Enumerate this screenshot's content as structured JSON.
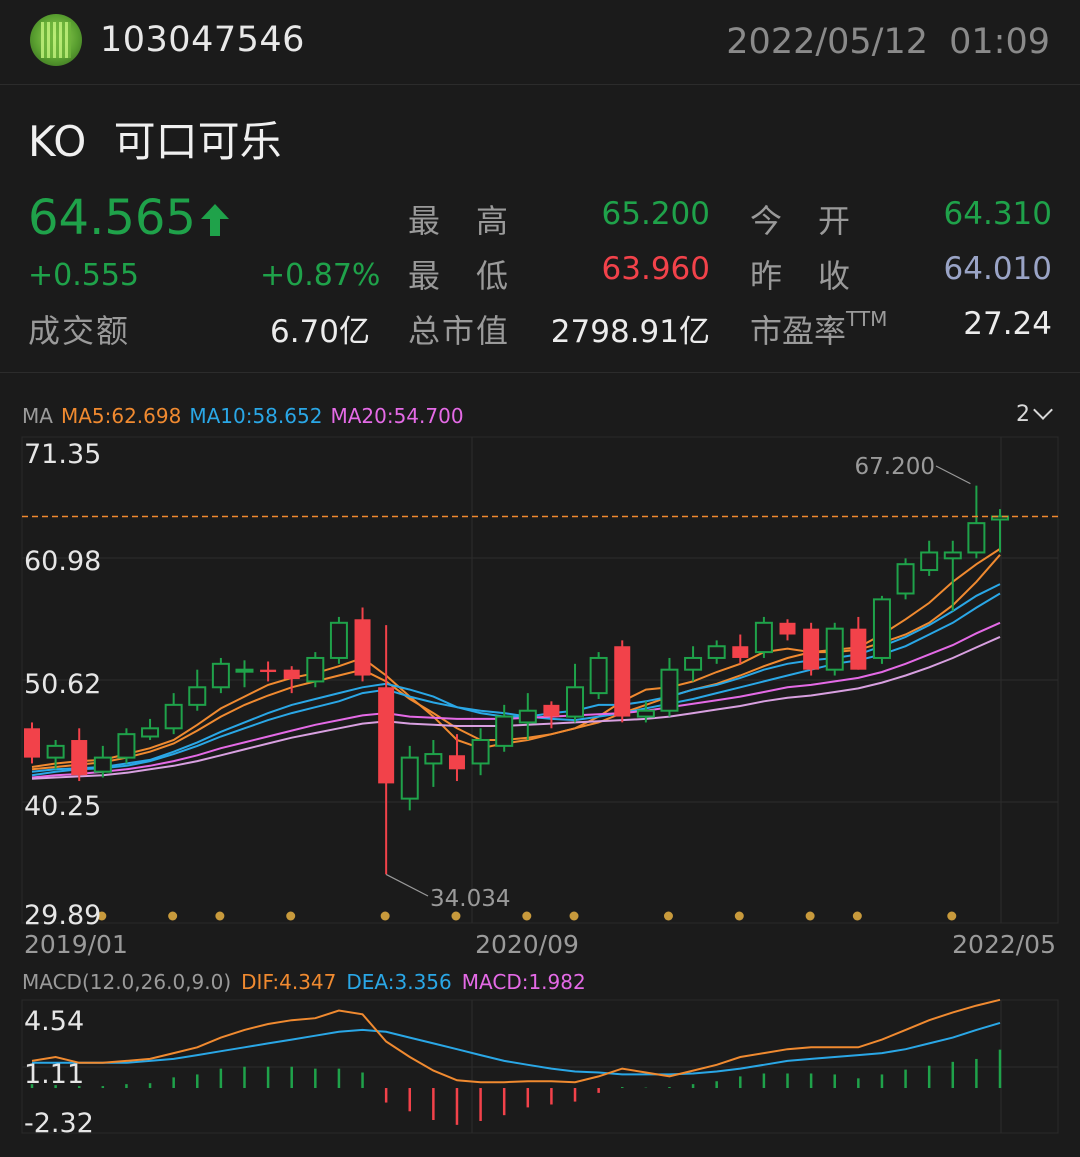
{
  "header": {
    "user_id": "103047546",
    "datetime": "2022/05/12  01:09"
  },
  "stock": {
    "symbol": "KO",
    "name": "可口可乐",
    "title": "KO  可口可乐",
    "price": "64.565",
    "change": "+0.555",
    "change_pct": "+0.87%",
    "turnover_label": "成交额",
    "turnover": "6.70亿",
    "high_label": "最　高",
    "high": "65.200",
    "low_label": "最　低",
    "low": "63.960",
    "mktcap_label": "总市值",
    "mktcap": "2798.91亿",
    "open_label": "今　开",
    "open": "64.310",
    "prevclose_label": "昨　收",
    "prevclose": "64.010",
    "pe_label": "市盈率",
    "pe_sup": "TTM",
    "pe": "27.24"
  },
  "colors": {
    "up": "#1fa24a",
    "down": "#f2424a",
    "ma5": "#f08a30",
    "ma10": "#2aa7e6",
    "ma20": "#e46ae6",
    "ma_extra": "#d8a0e0",
    "prevclose": "#9aa4c6",
    "event_dot": "#c89a3c"
  },
  "chart_data": [
    {
      "type": "candlestick",
      "period": "monthly",
      "indicator_label": "MA",
      "legend": [
        "MA5:62.698",
        "MA10:58.652",
        "MA20:54.700"
      ],
      "period_selector": "2",
      "y_ticks": [
        "71.35",
        "60.98",
        "50.62",
        "40.25",
        "29.89"
      ],
      "ylim": [
        29.89,
        71.35
      ],
      "x_ticks": [
        "2019/01",
        "2020/09",
        "2022/05"
      ],
      "annotations": {
        "max": "67.200",
        "min": "34.034"
      },
      "last_price": 64.565,
      "candles": [
        {
          "o": 46.5,
          "c": 44.0,
          "h": 47.0,
          "l": 43.5
        },
        {
          "o": 44.0,
          "c": 45.0,
          "h": 45.5,
          "l": 43.0
        },
        {
          "o": 45.5,
          "c": 42.5,
          "h": 46.5,
          "l": 42.0
        },
        {
          "o": 42.8,
          "c": 44.0,
          "h": 45.0,
          "l": 42.3
        },
        {
          "o": 44.0,
          "c": 46.0,
          "h": 46.5,
          "l": 43.5
        },
        {
          "o": 45.8,
          "c": 46.5,
          "h": 47.3,
          "l": 45.5
        },
        {
          "o": 46.5,
          "c": 48.5,
          "h": 49.5,
          "l": 46.0
        },
        {
          "o": 48.5,
          "c": 50.0,
          "h": 51.5,
          "l": 48.0
        },
        {
          "o": 50.0,
          "c": 52.0,
          "h": 52.5,
          "l": 49.5
        },
        {
          "o": 51.5,
          "c": 51.5,
          "h": 52.3,
          "l": 50.0
        },
        {
          "o": 51.5,
          "c": 51.3,
          "h": 52.2,
          "l": 50.5
        },
        {
          "o": 51.5,
          "c": 50.7,
          "h": 51.8,
          "l": 49.5
        },
        {
          "o": 50.5,
          "c": 52.5,
          "h": 53.0,
          "l": 50.0
        },
        {
          "o": 52.5,
          "c": 55.5,
          "h": 56.0,
          "l": 52.0
        },
        {
          "o": 55.8,
          "c": 51.0,
          "h": 56.8,
          "l": 50.5
        },
        {
          "o": 50.0,
          "c": 41.8,
          "h": 55.3,
          "l": 34.034
        },
        {
          "o": 40.5,
          "c": 44.0,
          "h": 45.0,
          "l": 39.5
        },
        {
          "o": 43.5,
          "c": 44.3,
          "h": 45.5,
          "l": 41.5
        },
        {
          "o": 44.2,
          "c": 43.0,
          "h": 46.0,
          "l": 42.0
        },
        {
          "o": 43.5,
          "c": 45.5,
          "h": 46.5,
          "l": 42.5
        },
        {
          "o": 45.0,
          "c": 47.5,
          "h": 48.5,
          "l": 44.5
        },
        {
          "o": 47.0,
          "c": 48.0,
          "h": 49.5,
          "l": 45.5
        },
        {
          "o": 48.5,
          "c": 47.5,
          "h": 48.8,
          "l": 46.5
        },
        {
          "o": 47.5,
          "c": 50.0,
          "h": 52.0,
          "l": 47.0
        },
        {
          "o": 49.5,
          "c": 52.5,
          "h": 53.0,
          "l": 49.0
        },
        {
          "o": 53.5,
          "c": 47.5,
          "h": 54.0,
          "l": 47.0
        },
        {
          "o": 47.5,
          "c": 48.0,
          "h": 48.8,
          "l": 47.0
        },
        {
          "o": 48.0,
          "c": 51.5,
          "h": 52.5,
          "l": 47.5
        },
        {
          "o": 51.5,
          "c": 52.5,
          "h": 53.5,
          "l": 50.5
        },
        {
          "o": 52.5,
          "c": 53.5,
          "h": 54.0,
          "l": 52.0
        },
        {
          "o": 53.5,
          "c": 52.5,
          "h": 54.5,
          "l": 52.0
        },
        {
          "o": 53.0,
          "c": 55.5,
          "h": 56.0,
          "l": 52.5
        },
        {
          "o": 55.5,
          "c": 54.5,
          "h": 55.8,
          "l": 54.0
        },
        {
          "o": 55.0,
          "c": 51.5,
          "h": 55.5,
          "l": 51.0
        },
        {
          "o": 51.5,
          "c": 55.0,
          "h": 55.5,
          "l": 51.0
        },
        {
          "o": 55.0,
          "c": 51.5,
          "h": 56.0,
          "l": 51.5
        },
        {
          "o": 52.5,
          "c": 57.5,
          "h": 57.8,
          "l": 52.0
        },
        {
          "o": 58.0,
          "c": 60.5,
          "h": 61.0,
          "l": 57.5
        },
        {
          "o": 60.0,
          "c": 61.5,
          "h": 62.5,
          "l": 59.5
        },
        {
          "o": 61.0,
          "c": 61.5,
          "h": 62.5,
          "l": 56.5
        },
        {
          "o": 61.5,
          "c": 64.0,
          "h": 67.2,
          "l": 61.0
        },
        {
          "o": 64.31,
          "c": 64.565,
          "h": 65.2,
          "l": 61.5
        }
      ],
      "ma_lines": [
        {
          "name": "MA5",
          "color_key": "ma5",
          "values": [
            43.2,
            43.5,
            43.7,
            43.8,
            44.3,
            44.8,
            45.5,
            46.8,
            48.2,
            49.2,
            50.2,
            50.8,
            51.2,
            51.8,
            52.5,
            51.0,
            49.2,
            47.5,
            45.5,
            44.8,
            45.2,
            45.5,
            46.0,
            46.5,
            47.5,
            48.8,
            49.8,
            50.0,
            50.5,
            51.3,
            52.0,
            53.0,
            53.3,
            53.0,
            53.2,
            53.4,
            54.5,
            55.8,
            57.2,
            59.0,
            60.5,
            61.8
          ]
        },
        {
          "name": "MA10(a)",
          "color_key": "ma5",
          "values": [
            43.0,
            43.2,
            43.4,
            43.6,
            44.0,
            44.5,
            45.2,
            46.3,
            47.5,
            48.5,
            49.3,
            50.0,
            50.5,
            51.0,
            51.5,
            50.5,
            49.0,
            47.8,
            46.5,
            45.5,
            45.5,
            45.7,
            46.0,
            46.5,
            47.0,
            47.8,
            48.5,
            49.2,
            49.8,
            50.3,
            51.0,
            51.8,
            52.5,
            53.0,
            53.0,
            53.2,
            53.8,
            54.5,
            55.5,
            57.0,
            59.0,
            61.3
          ]
        },
        {
          "name": "MA10",
          "color_key": "ma10",
          "values": [
            42.8,
            43.0,
            43.1,
            43.2,
            43.5,
            43.8,
            44.5,
            45.3,
            46.2,
            47.0,
            47.8,
            48.5,
            49.0,
            49.5,
            50.0,
            50.3,
            49.8,
            49.2,
            48.3,
            47.8,
            47.5,
            47.5,
            47.8,
            48.0,
            48.5,
            48.5,
            48.8,
            49.2,
            49.8,
            50.2,
            50.8,
            51.5,
            52.0,
            52.3,
            52.5,
            52.8,
            53.5,
            54.3,
            55.3,
            56.5,
            57.8,
            58.8
          ]
        },
        {
          "name": "MA10(b)",
          "color_key": "ma10",
          "values": [
            42.5,
            42.8,
            43.0,
            43.1,
            43.3,
            43.7,
            44.3,
            45.0,
            45.8,
            46.5,
            47.2,
            47.8,
            48.3,
            48.8,
            49.5,
            49.8,
            49.2,
            48.7,
            48.3,
            48.0,
            47.8,
            47.5,
            47.3,
            47.2,
            47.5,
            47.8,
            48.2,
            48.6,
            49.0,
            49.5,
            50.0,
            50.5,
            51.0,
            51.5,
            52.0,
            52.3,
            52.8,
            53.5,
            54.5,
            55.5,
            56.8,
            58.0
          ]
        },
        {
          "name": "MA20",
          "color_key": "ma20",
          "values": [
            42.3,
            42.5,
            42.6,
            42.8,
            43.0,
            43.3,
            43.7,
            44.2,
            44.8,
            45.3,
            45.8,
            46.3,
            46.8,
            47.2,
            47.6,
            47.8,
            47.5,
            47.4,
            47.3,
            47.3,
            47.3,
            47.4,
            47.5,
            47.6,
            47.7,
            47.8,
            48.0,
            48.3,
            48.6,
            48.9,
            49.2,
            49.6,
            50.0,
            50.2,
            50.5,
            50.8,
            51.3,
            52.0,
            52.8,
            53.6,
            54.6,
            55.5
          ]
        },
        {
          "name": "MA20(b)",
          "color_key": "ma_extra",
          "values": [
            42.2,
            42.3,
            42.4,
            42.5,
            42.7,
            43.0,
            43.3,
            43.7,
            44.2,
            44.7,
            45.2,
            45.7,
            46.1,
            46.5,
            46.9,
            47.1,
            46.9,
            46.8,
            46.7,
            46.7,
            46.7,
            46.8,
            46.9,
            47.0,
            47.1,
            47.2,
            47.3,
            47.5,
            47.8,
            48.1,
            48.4,
            48.8,
            49.1,
            49.3,
            49.6,
            49.9,
            50.4,
            51.0,
            51.7,
            52.5,
            53.4,
            54.3
          ]
        }
      ],
      "event_dot_indices": [
        3,
        6,
        8,
        11,
        15,
        18,
        21,
        23,
        27,
        30,
        33,
        35,
        39
      ]
    },
    {
      "type": "macd",
      "label": "MACD(12.0,26.0,9.0)",
      "legend": [
        "DIF:4.347",
        "DEA:3.356",
        "MACD:1.982"
      ],
      "y_ticks": [
        "4.54",
        "1.11",
        "-2.32"
      ],
      "ylim": [
        -2.32,
        4.54
      ],
      "dif": [
        1.4,
        1.6,
        1.3,
        1.3,
        1.4,
        1.5,
        1.8,
        2.1,
        2.6,
        3.0,
        3.3,
        3.5,
        3.6,
        4.0,
        3.8,
        2.4,
        1.6,
        0.9,
        0.4,
        0.3,
        0.3,
        0.35,
        0.35,
        0.3,
        0.6,
        1.0,
        0.8,
        0.6,
        0.9,
        1.2,
        1.6,
        1.8,
        2.0,
        2.1,
        2.1,
        2.1,
        2.5,
        3.0,
        3.5,
        3.9,
        4.25,
        4.55
      ],
      "dea": [
        1.3,
        1.3,
        1.3,
        1.3,
        1.3,
        1.4,
        1.5,
        1.7,
        1.9,
        2.1,
        2.3,
        2.5,
        2.7,
        2.9,
        3.0,
        2.9,
        2.6,
        2.3,
        2.0,
        1.7,
        1.4,
        1.2,
        1.0,
        0.85,
        0.8,
        0.7,
        0.7,
        0.7,
        0.75,
        0.85,
        1.0,
        1.2,
        1.4,
        1.5,
        1.6,
        1.7,
        1.8,
        2.0,
        2.3,
        2.6,
        3.0,
        3.36
      ],
      "macd": [
        0.2,
        0.15,
        0.1,
        0.1,
        0.2,
        0.25,
        0.55,
        0.7,
        1.0,
        1.1,
        1.1,
        1.1,
        1.0,
        1.0,
        0.8,
        -0.75,
        -1.2,
        -1.65,
        -1.9,
        -1.7,
        -1.4,
        -1.0,
        -0.85,
        -0.7,
        -0.25,
        0.05,
        0.02,
        0.05,
        0.2,
        0.35,
        0.6,
        0.75,
        0.75,
        0.75,
        0.7,
        0.5,
        0.7,
        0.95,
        1.15,
        1.35,
        1.5,
        1.98
      ]
    }
  ]
}
